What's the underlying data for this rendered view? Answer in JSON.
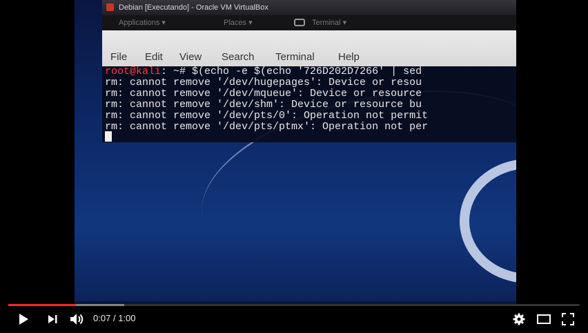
{
  "player": {
    "time_current": "0:07",
    "time_separator": "/",
    "time_total": "1:00",
    "progress": {
      "played_fraction": 0.118,
      "buffered_fraction": 0.203
    },
    "colors": {
      "played": "#f12b24"
    },
    "icons": [
      "play-icon",
      "next-icon",
      "volume-icon",
      "settings-icon",
      "theater-mode-icon",
      "fullscreen-icon"
    ]
  },
  "vm_window": {
    "title": "Debian [Executando] - Oracle VM VirtualBox"
  },
  "gnome_bar": {
    "applications": "Applications",
    "places": "Places",
    "terminal": "Terminal"
  },
  "terminal": {
    "menu": [
      "File",
      "Edit",
      "View",
      "Search",
      "Terminal",
      "Help"
    ],
    "prompt_user": "root@kali",
    "command": ": ~# $(echo -e $(echo '726D202D7266' | sed",
    "lines": [
      "rm: cannot remove '/dev/hugepages': Device or resou",
      "rm: cannot remove '/dev/mqueue': Device or resource",
      "rm: cannot remove '/dev/shm': Device or resource bu",
      "rm: cannot remove '/dev/pts/0': Operation not permit",
      "rm: cannot remove '/dev/pts/ptmx': Operation not per"
    ]
  }
}
